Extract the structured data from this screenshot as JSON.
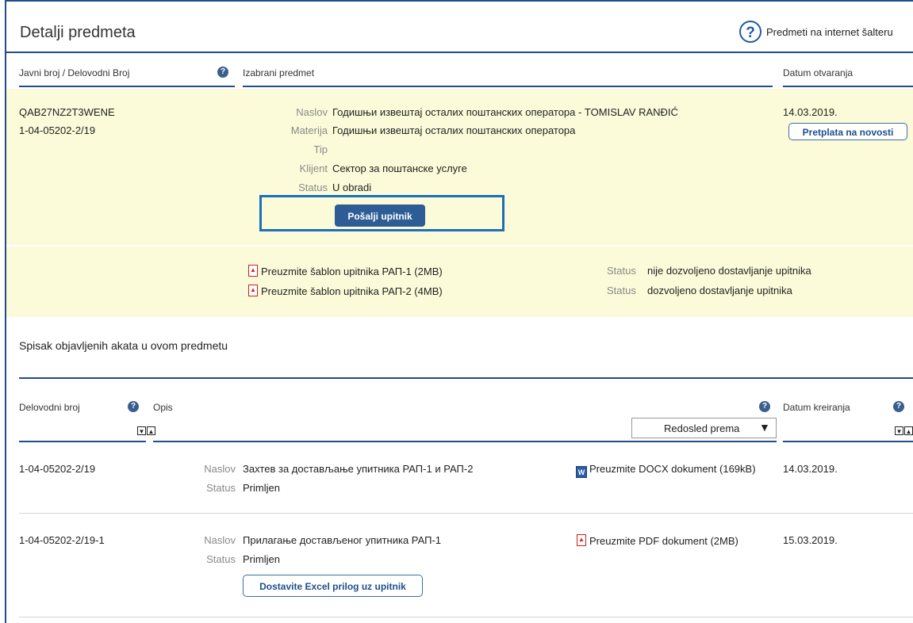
{
  "header": {
    "title": "Detalji predmeta",
    "help_link": "Predmeti na internet šalteru"
  },
  "case_table": {
    "col_public_number": "Javni broj / Delovodni Broj",
    "col_selected_case": "Izabrani predmet",
    "col_open_date": "Datum otvaranja",
    "public_number": "QAB27NZ2T3WENE",
    "delovodni_broj": "1-04-05202-2/19",
    "fields": [
      {
        "label": "Naslov",
        "value": "Годишњи извештај осталих поштанских оператора - TOMISLAV RANĐIĆ"
      },
      {
        "label": "Materija",
        "value": "Годишњи извештај осталих поштанских оператора"
      },
      {
        "label": "Tip",
        "value": ""
      },
      {
        "label": "Klijent",
        "value": "Сектор за поштанске услуге"
      },
      {
        "label": "Status",
        "value": "U obradi"
      }
    ],
    "send_button": "Pošalji upitnik",
    "open_date": "14.03.2019.",
    "subscribe_button": "Pretplata na novosti"
  },
  "templates": [
    {
      "link": "Preuzmite šablon upitnika РАП-1 (2MB)",
      "status_label": "Status",
      "status_value": "nije dozvoljeno dostavljanje upitnika"
    },
    {
      "link": "Preuzmite šablon upitnika РАП-2 (4MB)",
      "status_label": "Status",
      "status_value": "dozvoljeno dostavljanje upitnika"
    }
  ],
  "acts_section": {
    "title": "Spisak objavljenih akata u ovom predmetu",
    "col_delovodni": "Delovodni broj",
    "col_opis": "Opis",
    "col_datum": "Datum kreiranja",
    "sort_label": "Redosled prema",
    "rows": [
      {
        "number": "1-04-05202-2/19",
        "naslov_label": "Naslov",
        "naslov": "Захтев за достављање упитника РАП-1 и РАП-2",
        "status_label": "Status",
        "status": "Primljen",
        "download": "Preuzmite DOCX dokument (169kB)",
        "date": "14.03.2019."
      },
      {
        "number": "1-04-05202-2/19-1",
        "naslov_label": "Naslov",
        "naslov": "Прилагање достављеног упитника РАП-1",
        "status_label": "Status",
        "status": "Primljen",
        "download": "Preuzmite PDF dokument (2MB)",
        "date": "15.03.2019.",
        "action_button": "Dostavite Excel prilog uz upitnik"
      }
    ]
  },
  "icons": {
    "help": "question-mark-icon",
    "pdf": "pdf-icon",
    "docx": "docx-icon",
    "sort_down": "sort-descending-icon",
    "sort_up": "sort-ascending-icon",
    "dropdown": "dropdown-arrow-icon"
  },
  "colors": {
    "brand_blue": "#1f4e8c",
    "button_blue": "#2e5d95",
    "highlight_yellow": "#fbfbd9",
    "highlight_frame": "#1d6fb8"
  }
}
